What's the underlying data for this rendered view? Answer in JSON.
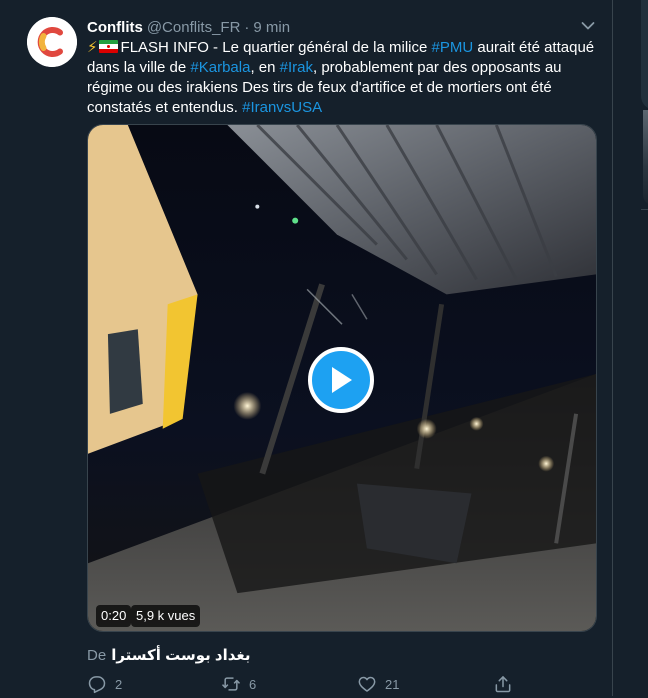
{
  "tweet": {
    "author_name": "Conflits",
    "author_handle": "@Conflits_FR",
    "separator": "·",
    "time": "9 min",
    "text": {
      "t1": "FLASH INFO - Le quartier général de la milice ",
      "h1": "#PMU",
      "t2": " aurait été attaqué dans la ville de ",
      "h2": "#Karbala",
      "t3": ", en ",
      "h3": "#Irak",
      "t4": ", probablement par des opposants au régime ou des irakiens Des tirs de feux d'artifice et de mortiers ont été constatés et entendus. ",
      "h4": "#IranvsUSA"
    },
    "video": {
      "duration": "0:20",
      "views": "5,9 k vues"
    },
    "attribution": {
      "from_label": "De",
      "source": "بغداد بوست أكسترا"
    },
    "actions": {
      "replies": "2",
      "retweets": "6",
      "likes": "21"
    }
  },
  "colors": {
    "background": "#15202b",
    "accent": "#1da1f2",
    "link": "#1b95e0",
    "secondary_text": "#8899a6"
  },
  "icons": [
    "chevron-down-icon",
    "reply-icon",
    "retweet-icon",
    "like-icon",
    "share-icon",
    "play-icon",
    "lightning-icon",
    "iran-flag-icon"
  ]
}
